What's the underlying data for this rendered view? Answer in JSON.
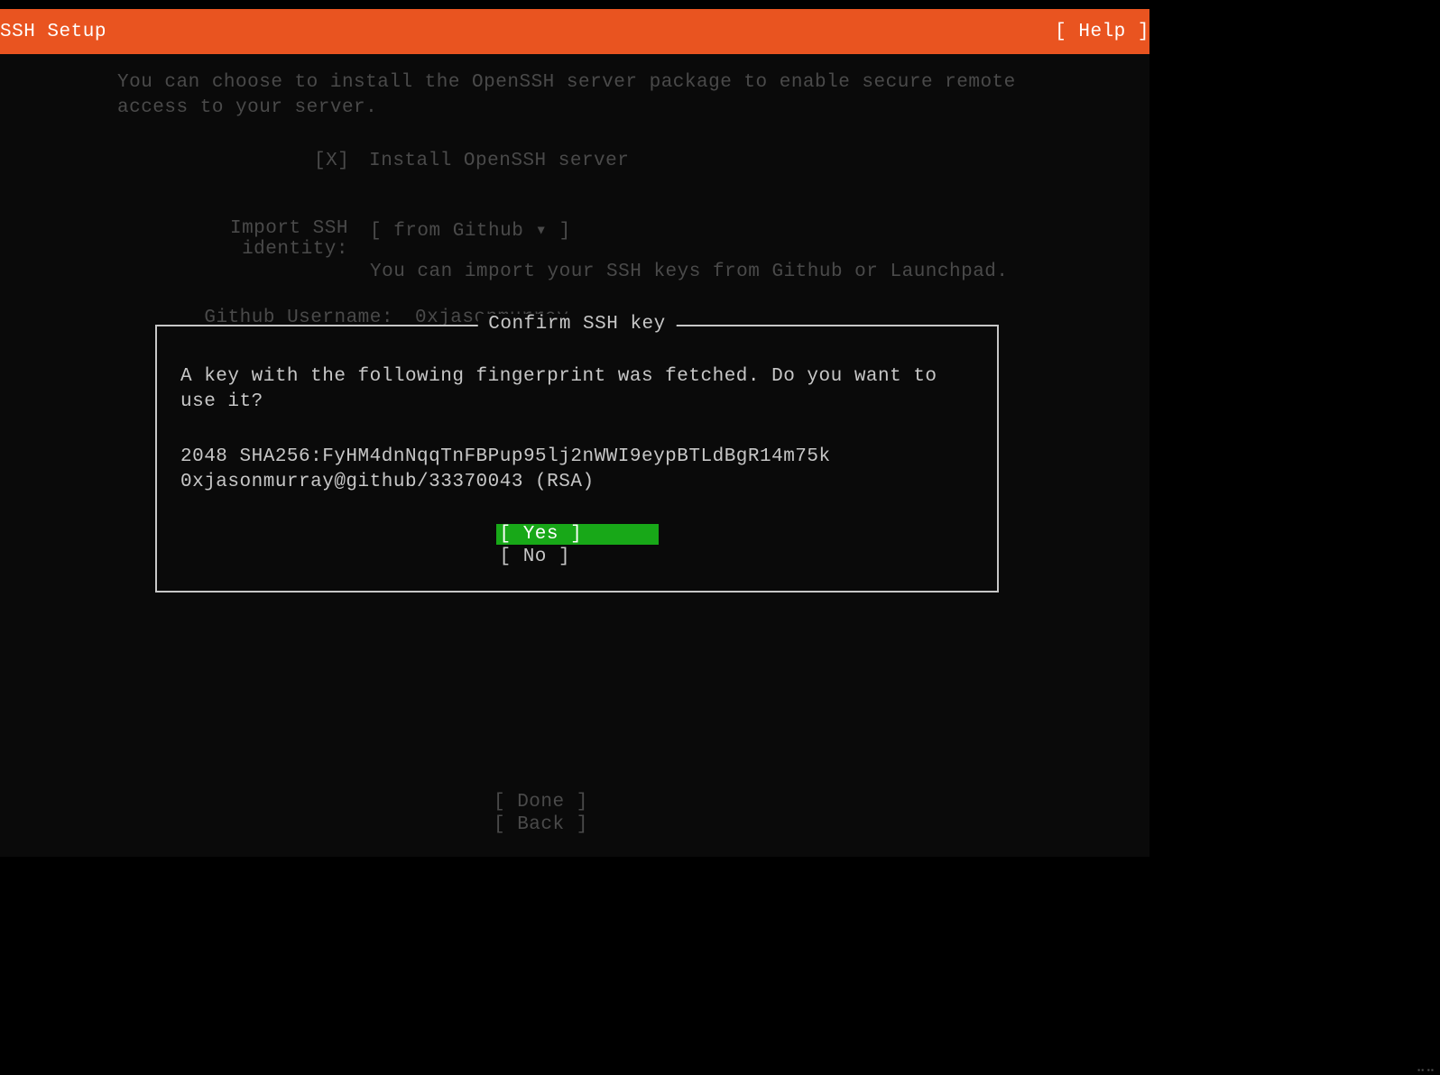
{
  "header": {
    "title": "SSH Setup",
    "help_label": "[ Help ]"
  },
  "intro": "You can choose to install the OpenSSH server package to enable secure remote access to your server.",
  "checkbox": {
    "mark": "[X]",
    "label": "Install OpenSSH server"
  },
  "import_identity": {
    "label": "Import SSH identity:",
    "value": "[ from Github     ▾ ]",
    "hint": "You can import your SSH keys from Github or Launchpad."
  },
  "github_username": {
    "label": "Github Username:",
    "value": "0xjasonmurray"
  },
  "dialog": {
    "title": " Confirm SSH key ",
    "question": "A key with the following fingerprint was fetched. Do you want to use it?",
    "fingerprint_line1": "2048 SHA256:FyHM4dnNqqTnFBPup95lj2nWWI9eypBTLdBgR14m75k",
    "fingerprint_line2": "0xjasonmurray@github/33370043  (RSA)",
    "yes_label": "[ Yes         ]",
    "no_label": "[ No          ]"
  },
  "footer": {
    "done_label": "[ Done        ]",
    "back_label": "[ Back        ]"
  }
}
